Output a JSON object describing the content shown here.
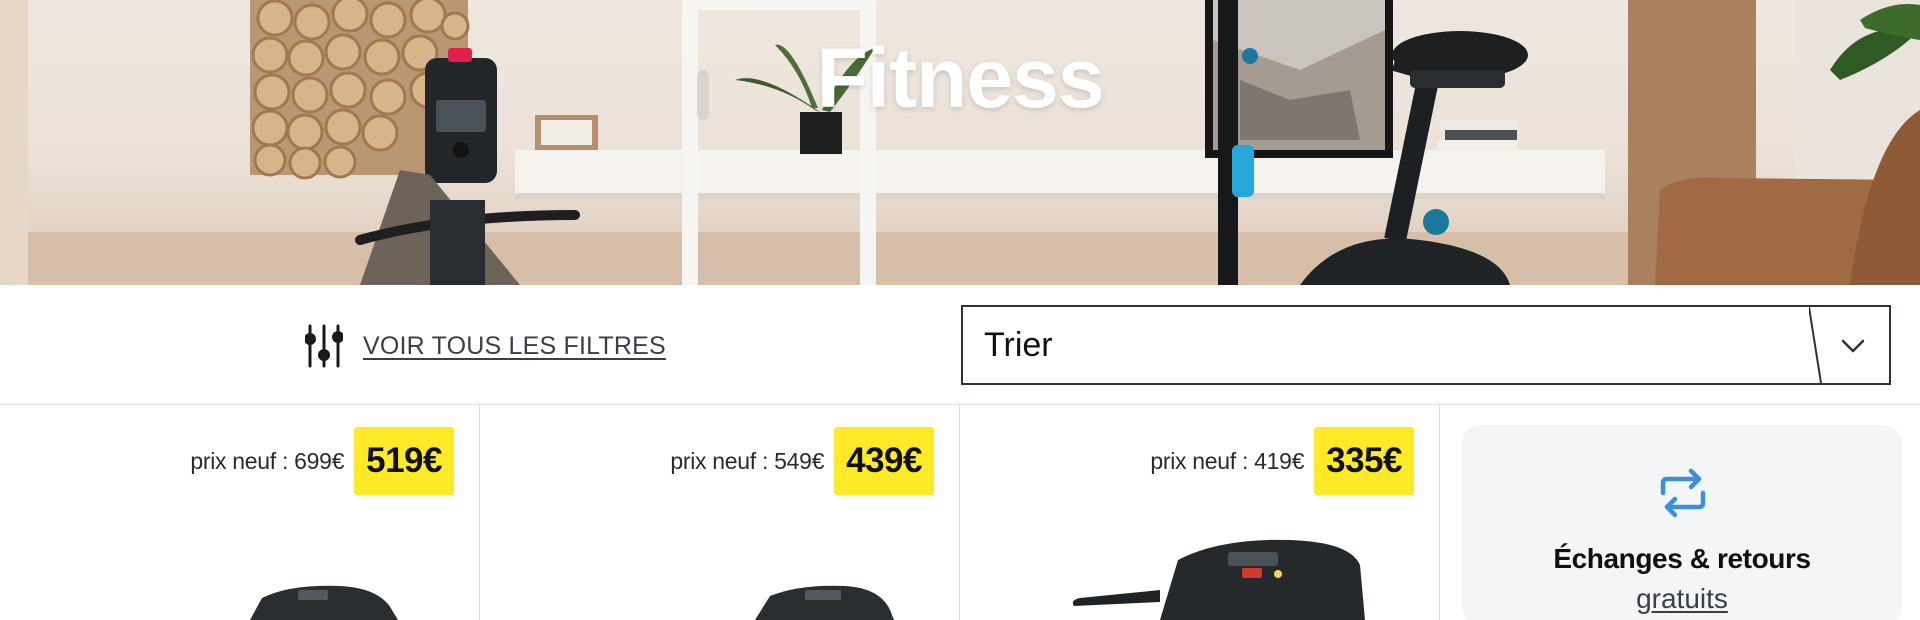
{
  "hero": {
    "title": "Fitness"
  },
  "toolbar": {
    "filters_label": "VOIR TOUS LES FILTRES",
    "sort_value": "Trier"
  },
  "products": [
    {
      "old_price": "prix neuf : 699€",
      "price": "519€"
    },
    {
      "old_price": "prix neuf : 549€",
      "price": "439€"
    },
    {
      "old_price": "prix neuf : 419€",
      "price": "335€"
    }
  ],
  "promo": {
    "title": "Échanges & retours",
    "link": "gratuits"
  },
  "colors": {
    "price_badge": "#ffea28",
    "accent_blue": "#3b8fdc",
    "border": "#d9dde1"
  },
  "icons": {
    "filters": "sliders-icon",
    "sort": "chevron-down-icon",
    "promo": "exchange-arrows-icon"
  }
}
